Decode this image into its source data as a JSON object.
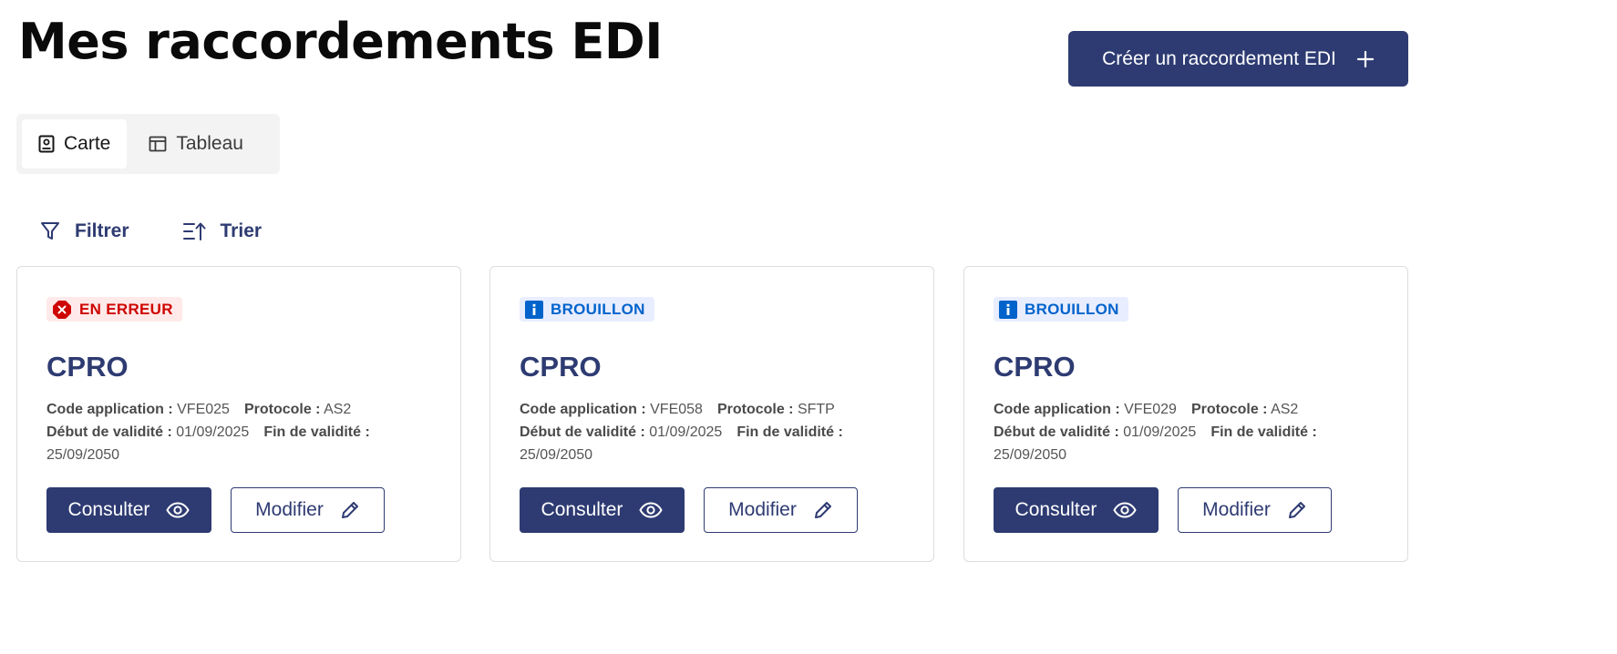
{
  "header": {
    "title": "Mes raccordements EDI",
    "create_button_label": "Créer un raccordement EDI",
    "create_button_icon": "plus-icon"
  },
  "view_switch": {
    "options": [
      {
        "label": "Carte",
        "icon": "card-view-icon",
        "selected": true
      },
      {
        "label": "Tableau",
        "icon": "table-view-icon",
        "selected": false
      }
    ]
  },
  "toolbar": {
    "filter_label": "Filtrer",
    "sort_label": "Trier"
  },
  "labels": {
    "code_application": "Code application :",
    "protocole": "Protocole :",
    "debut_validite": "Début de validité :",
    "fin_validite": "Fin de validité :",
    "consult": "Consulter",
    "modify": "Modifier"
  },
  "cards": [
    {
      "status": "EN ERREUR",
      "status_type": "error",
      "title": "CPRO",
      "code_application": "VFE025",
      "protocole": "AS2",
      "debut_validite": "01/09/2025",
      "fin_validite": "25/09/2050"
    },
    {
      "status": "BROUILLON",
      "status_type": "info",
      "title": "CPRO",
      "code_application": "VFE058",
      "protocole": "SFTP",
      "debut_validite": "01/09/2025",
      "fin_validite": "25/09/2050"
    },
    {
      "status": "BROUILLON",
      "status_type": "info",
      "title": "CPRO",
      "code_application": "VFE029",
      "protocole": "AS2",
      "debut_validite": "01/09/2025",
      "fin_validite": "25/09/2050"
    }
  ],
  "colors": {
    "primary": "#2e3b72",
    "error": "#ce0500",
    "error_bg": "#ffe9e9",
    "info": "#0063cb",
    "info_bg": "#e8edff"
  }
}
